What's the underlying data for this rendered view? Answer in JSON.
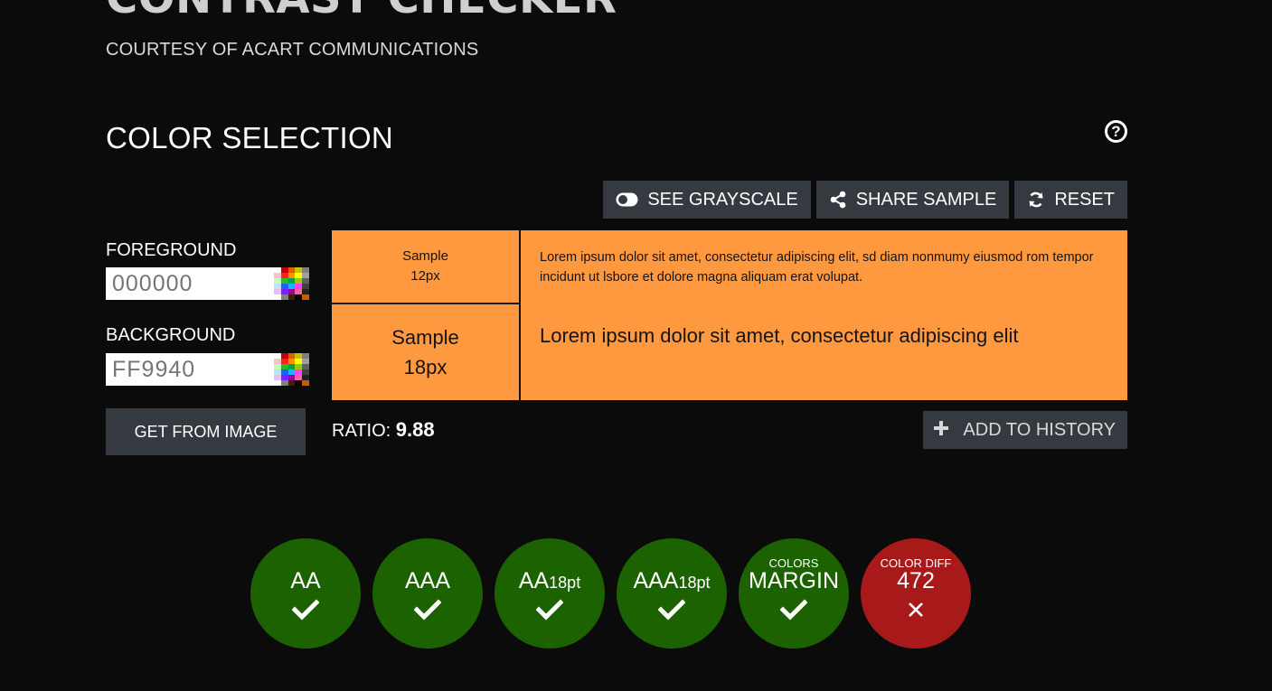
{
  "header": {
    "title": "CONTRAST CHECKER",
    "subtitle": "COURTESY OF ACART COMMUNICATIONS"
  },
  "section": {
    "title": "COLOR SELECTION",
    "help_icon": "question-circle-icon"
  },
  "toolbar": {
    "grayscale_label": "SEE GRAYSCALE",
    "share_label": "SHARE SAMPLE",
    "reset_label": "RESET"
  },
  "foreground": {
    "label": "FOREGROUND",
    "placeholder": "000000",
    "value": ""
  },
  "background": {
    "label": "BACKGROUND",
    "placeholder": "FF9940",
    "value": ""
  },
  "get_from_image_label": "GET FROM IMAGE",
  "samples": {
    "bg_color": "#FF9940",
    "fg_color": "#141414",
    "small_label": "Sample",
    "small_size": "12px",
    "small_text": "Lorem ipsum dolor sit amet, consectetur adipiscing elit, sd diam nonmumy eiusmod rom tempor incidunt ut lsbore et dolore magna aliquam erat volupat.",
    "large_label": "Sample",
    "large_size": "18px",
    "large_text": "Lorem ipsum dolor sit amet, consectetur adipiscing elit"
  },
  "ratio": {
    "label": "RATIO:",
    "value": "9.88"
  },
  "add_history_label": "ADD TO HISTORY",
  "results": [
    {
      "main": "AA",
      "sub": "",
      "top": "",
      "status": "pass"
    },
    {
      "main": "AAA",
      "sub": "",
      "top": "",
      "status": "pass"
    },
    {
      "main": "AA",
      "sub": "18pt",
      "top": "",
      "status": "pass"
    },
    {
      "main": "AAA",
      "sub": "18pt",
      "top": "",
      "status": "pass"
    },
    {
      "main": "MARGIN",
      "sub": "",
      "top": "COLORS",
      "status": "pass"
    },
    {
      "main": "472",
      "sub": "",
      "top": "COLOR DIFF",
      "status": "fail"
    }
  ],
  "colors": {
    "pass": "#1C6200",
    "fail": "#A81A1A",
    "button": "#343A40"
  }
}
